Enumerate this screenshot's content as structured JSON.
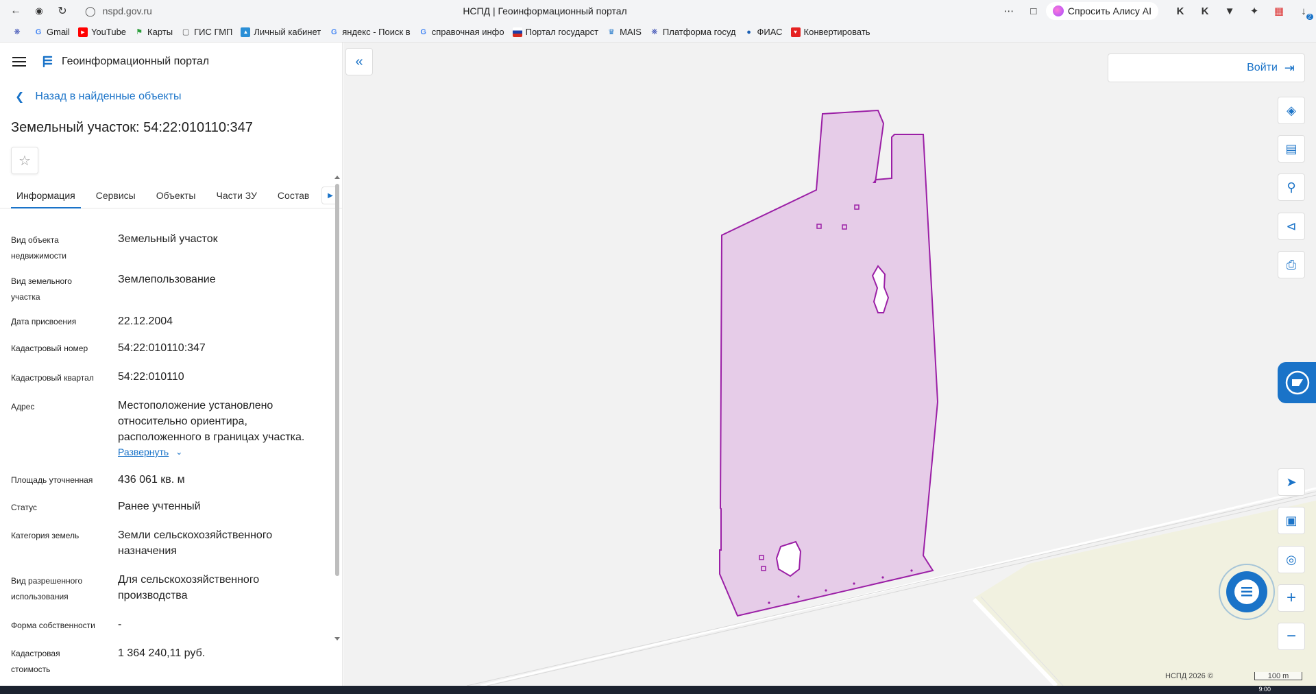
{
  "browser": {
    "url": "nspd.gov.ru",
    "title": "НСПД | Геоинформационный портал",
    "alice_label": "Спросить Алису AI",
    "notification_count": "2",
    "bookmarks": [
      "",
      "Gmail",
      "YouTube",
      "Карты",
      "ГИС ГМП",
      "Личный кабинет",
      "яндекс - Поиск в",
      "справочная инфо",
      "Портал государст",
      "MAIS",
      "Платформа госуд",
      "ФИАС",
      "Конвертировать"
    ]
  },
  "panel": {
    "app_title": "Геоинформационный портал",
    "back_label": "Назад в найденные объекты",
    "heading": "Земельный участок: 54:22:010110:347",
    "tabs": [
      "Информация",
      "Сервисы",
      "Объекты",
      "Части ЗУ",
      "Состав"
    ],
    "properties": [
      {
        "label": "Вид объекта недвижимости",
        "value": "Земельный участок"
      },
      {
        "label": "Вид земельного участка",
        "value": "Землепользование"
      },
      {
        "label": "Дата присвоения",
        "value": "22.12.2004"
      },
      {
        "label": "Кадастровый номер",
        "value": "54:22:010110:347"
      },
      {
        "label": "Кадастровый квартал",
        "value": "54:22:010110"
      },
      {
        "label": "Адрес",
        "value": "Местоположение установлено относительно ориентира, расположенного в границах участка."
      },
      {
        "label": "Площадь уточненная",
        "value": "436 061 кв. м"
      },
      {
        "label": "Статус",
        "value": "Ранее учтенный"
      },
      {
        "label": "Категория земель",
        "value": "Земли сельскохозяйственного назначения"
      },
      {
        "label": "Вид разрешенного использования",
        "value": "Для сельскохозяйственного производства"
      },
      {
        "label": "Форма собственности",
        "value": "-"
      },
      {
        "label": "Кадастровая стоимость",
        "value": "1 364 240,11 руб."
      }
    ],
    "expand_label": "Развернуть"
  },
  "map": {
    "login_label": "Войти",
    "copyright": "НСПД 2026 ©",
    "scale": "100 m",
    "parcel_fill": "#e6cce8",
    "parcel_stroke": "#9b1fa6",
    "accent": "#1a73c8"
  },
  "taskbar": {
    "clock": "9:00"
  }
}
